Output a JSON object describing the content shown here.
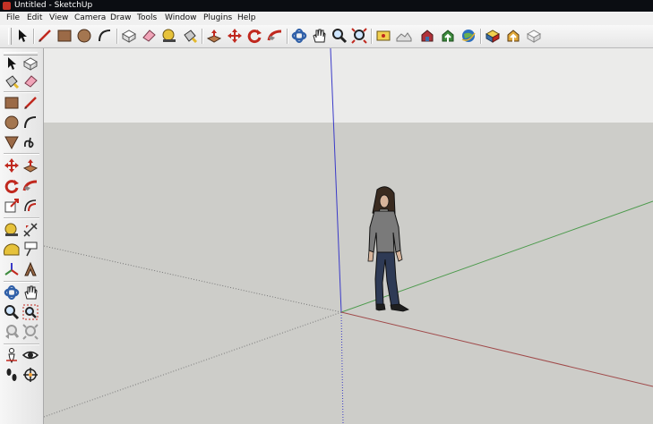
{
  "window": {
    "title": "Untitled - SketchUp"
  },
  "menu": [
    "File",
    "Edit",
    "View",
    "Camera",
    "Draw",
    "Tools",
    "Window",
    "Plugins",
    "Help"
  ],
  "colors": {
    "sky": "#ebebea",
    "ground": "#cdcdc9",
    "red_axis": "#a04a4a",
    "green_axis": "#4c9a4c",
    "blue_axis": "#3a3ac8"
  },
  "top_toolbar": [
    "select-icon",
    "line-icon",
    "rectangle-icon",
    "circle-icon",
    "arc-icon",
    "make-component-icon",
    "eraser-icon",
    "tape-measure-icon",
    "paint-bucket-icon",
    "push-pull-icon",
    "move-icon",
    "rotate-icon",
    "follow-me-icon",
    "orbit-icon",
    "pan-icon",
    "zoom-icon",
    "zoom-extents-icon",
    "add-location-icon",
    "toggle-terrain-icon",
    "get-models-icon",
    "share-model-icon",
    "google-earth-icon",
    "share-component-icon",
    "get-photo-texture-icon",
    "preview-in-earth-icon"
  ],
  "left_toolbar": [
    "select-icon",
    "make-component-icon",
    "paint-bucket-icon",
    "eraser-icon",
    "rectangle-icon",
    "line-icon",
    "circle-icon",
    "arc-icon",
    "polygon-icon",
    "freehand-icon",
    "move-icon",
    "push-pull-icon",
    "rotate-icon",
    "follow-me-icon",
    "scale-icon",
    "offset-icon",
    "tape-measure-icon",
    "dimension-icon",
    "protractor-icon",
    "text-icon",
    "axes-icon",
    "3d-text-icon",
    "orbit-icon",
    "pan-icon",
    "zoom-icon",
    "zoom-window-icon",
    "previous-view-icon",
    "zoom-extents-icon",
    "position-camera-icon",
    "look-around-icon",
    "walk-icon",
    "section-plane-icon"
  ]
}
